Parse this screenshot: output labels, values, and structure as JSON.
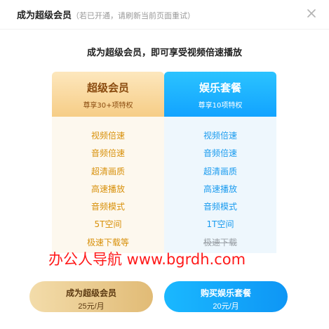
{
  "header": {
    "title": "成为超级会员",
    "note": "（若已开通，请刷新当前页面重试）",
    "close_icon": "close-icon"
  },
  "subtitle": "成为超级会员，即可享受视频倍速播放",
  "plans": {
    "vip": {
      "name": "超级会员",
      "tagline": "尊享30+项特权",
      "features": [
        "视频倍速",
        "音频倍速",
        "超清画质",
        "高速播放",
        "音频模式",
        "5T空间",
        "极速下载等"
      ]
    },
    "entertainment": {
      "name": "娱乐套餐",
      "tagline": "尊享10项特权",
      "features": [
        "视频倍速",
        "音频倍速",
        "超清画质",
        "高速播放",
        "音频模式",
        "1T空间",
        "极速下载"
      ]
    }
  },
  "watermark": "办公人导航 www.bgrdh.com",
  "buttons": {
    "vip": {
      "label": "成为超级会员",
      "price": "25元/月"
    },
    "entertainment": {
      "label": "购买娱乐套餐",
      "price": "20元/月"
    }
  },
  "colors": {
    "vip_accent": "#d8900a",
    "entertainment_accent": "#1a9bef",
    "watermark": "#ff1a1a"
  }
}
